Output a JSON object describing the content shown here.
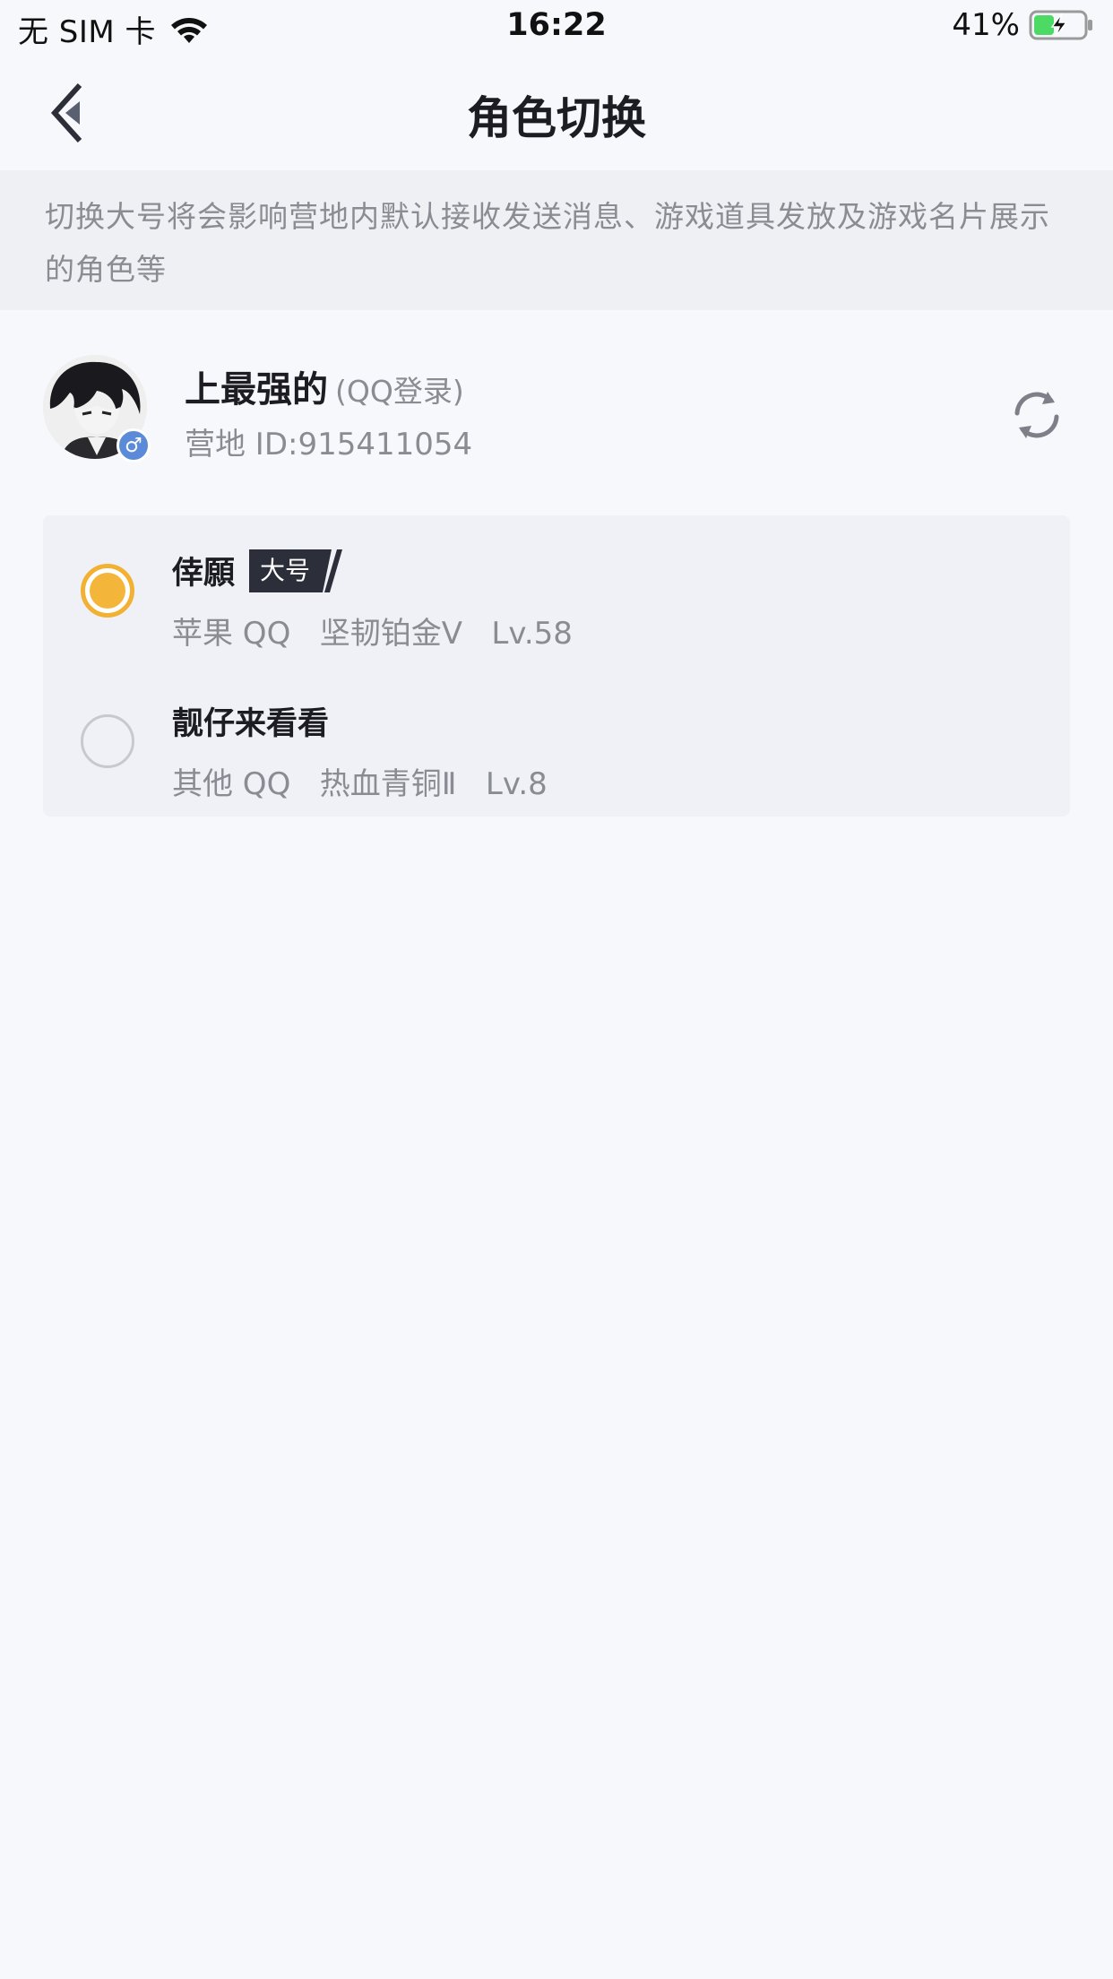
{
  "status_bar": {
    "carrier": "无 SIM 卡",
    "wifi_icon": "wifi-icon",
    "time": "16:22",
    "battery_percent": "41%",
    "battery_level": 0.41,
    "battery_icon": "battery-charging-icon",
    "battery_color": "#4cd964"
  },
  "nav": {
    "back_icon": "chevron-left-icon",
    "title": "角色切换"
  },
  "notice": {
    "text": "切换大号将会影响营地内默认接收发送消息、游戏道具发放及游戏名片展示的角色等"
  },
  "profile": {
    "avatar_icon": "user-avatar",
    "gender_icon": "male-icon",
    "gender_symbol": "♂",
    "name": "上最强的",
    "login_type": "(QQ登录)",
    "camp_id": "营地 ID:915411054",
    "refresh_icon": "refresh-icon"
  },
  "roles": [
    {
      "name": "倖願",
      "badge": "大号",
      "detail": "苹果 QQ   坚韧铂金Ⅴ   Lv.58",
      "selected": true
    },
    {
      "name": "靓仔来看看",
      "detail": "其他 QQ   热血青铜Ⅱ   Lv.8",
      "selected": false
    }
  ],
  "colors": {
    "accent": "#f3b63a",
    "badge_bg": "#2c2f39",
    "gender": "#5b8ad8",
    "text_secondary": "#8a8c93",
    "background": "#f7f8fb"
  }
}
